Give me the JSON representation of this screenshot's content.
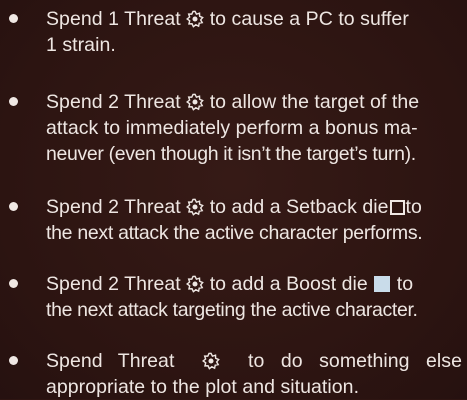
{
  "items": [
    {
      "lines": [
        {
          "before": "Spend 1 Threat",
          "icon": "threat-symbol",
          "after": "to cause a PC to suffer"
        },
        {
          "text": "1 strain."
        }
      ]
    },
    {
      "lines": [
        {
          "before": "Spend 2 Threat",
          "icon": "threat-symbol",
          "after": "to allow the target of the"
        },
        {
          "text": "attack to immediately perform a bonus ma-"
        },
        {
          "text": "neuver (even though it isn’t the target’s turn)."
        }
      ]
    },
    {
      "lines": [
        {
          "before": "Spend 2 Threat",
          "icon": "threat-symbol",
          "after": "to add a Setback die",
          "die": "setback-die",
          "after_die": "to"
        },
        {
          "text": "the next attack the active character performs."
        }
      ]
    },
    {
      "lines": [
        {
          "before": "Spend 2 Threat",
          "icon": "threat-symbol",
          "after": "to add a Boost die",
          "die": "boost-die",
          "after_die": "to"
        },
        {
          "text": "the next attack targeting the active character."
        }
      ]
    },
    {
      "lines": [
        {
          "before": "Spend Threat",
          "icon": "threat-symbol",
          "after": "to do something else"
        },
        {
          "text": "appropriate to the plot and situation."
        }
      ]
    }
  ],
  "colors": {
    "background": "#2e1512",
    "text": "#eee6e2",
    "boost_die": "#c9dcea"
  }
}
